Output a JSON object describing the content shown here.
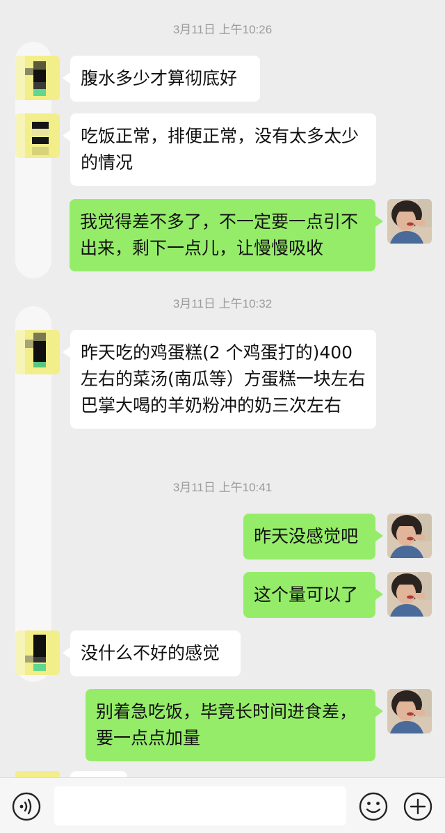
{
  "chat": {
    "timestamps": [
      "3月11日 上午10:26",
      "3月11日 上午10:32",
      "3月11日 上午10:41"
    ],
    "messages": [
      {
        "text": "腹水多少才算彻底好"
      },
      {
        "text": "吃饭正常，排便正常，没有太多太少的情况"
      },
      {
        "text": "我觉得差不多了，不一定要一点引不出来，剩下一点儿，让慢慢吸收"
      },
      {
        "text": "昨天吃的鸡蛋糕(2 个鸡蛋打的)400左右的菜汤(南瓜等）方蛋糕一块左右巴掌大喝的羊奶粉冲的奶三次左右"
      },
      {
        "text": "昨天没感觉吧"
      },
      {
        "text": "这个量可以了"
      },
      {
        "text": "没什么不好的感觉"
      },
      {
        "text": "别着急吃饭，毕竟长时间进食差，要一点点加量"
      }
    ]
  },
  "input_bar": {
    "input_value": "",
    "icons": [
      "voice-icon",
      "emoji-icon",
      "plus-icon"
    ]
  },
  "colors": {
    "background": "#ededed",
    "incoming_bubble": "#ffffff",
    "outgoing_bubble": "#95ec69",
    "timestamp_text": "#9b9b9b",
    "pixelated_avatar_yellow": "#f2ee8a"
  }
}
